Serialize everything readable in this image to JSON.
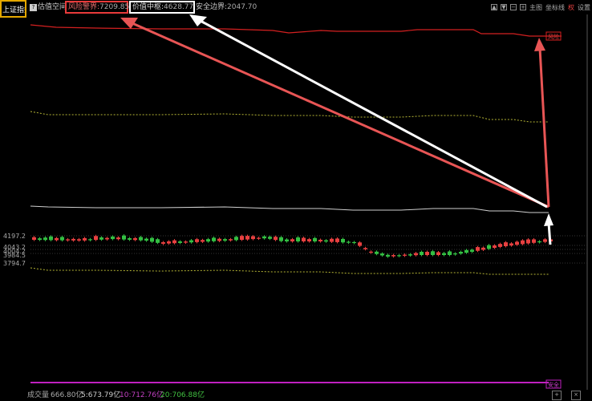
{
  "topbar": {
    "index_name": "上证指数",
    "help_glyph": "?",
    "valuation_space": "估值空间",
    "risk_label": "风险警界:",
    "risk_value": "7209.85",
    "mid_label": "价值中枢:",
    "mid_value": "4628.77",
    "safe_label": "安全边界:",
    "safe_value": "2047.70",
    "main_chart": "主图",
    "coordinates": "坐标线",
    "auth": "权",
    "settings": "设置"
  },
  "y_labels": [
    "4197.2",
    "4043.2",
    "4004.2",
    "3984.5",
    "3794.7"
  ],
  "tags": {
    "risk": "风险",
    "safe": "安全"
  },
  "bottombar": {
    "volume_label": "成交量",
    "volume_value": "666.80亿",
    "ma5": "5:673.79亿",
    "ma10": "10:712.76亿",
    "ma20": "20:706.88亿"
  },
  "colors": {
    "risk": "#d42020",
    "mid": "#cfcfcf",
    "dashed": "#b5b535",
    "up": "#e84040",
    "down": "#33c043",
    "volume": "#c020c0",
    "arrow_red": "#e85555",
    "arrow_white": "#ffffff"
  }
}
